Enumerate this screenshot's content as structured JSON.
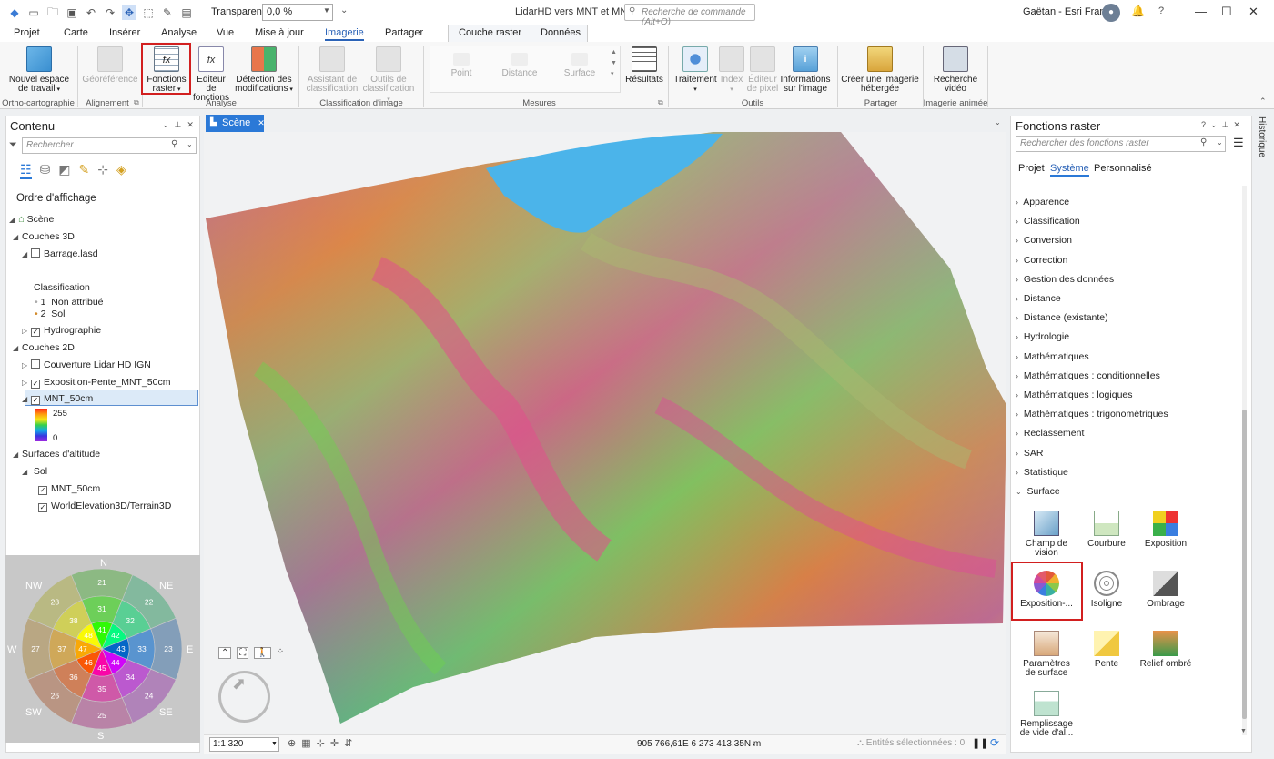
{
  "titlebar": {
    "transparency_label": "Transparence",
    "transparency_value": "0,0 %",
    "app_title": "LidarHD vers MNT et MNS",
    "command_search_placeholder": "Recherche de commande (Alt+Q)",
    "user": "Gaëtan - Esri France"
  },
  "menu": {
    "tabs": [
      "Projet",
      "Carte",
      "Insérer",
      "Analyse",
      "Vue",
      "Mise à jour",
      "Imagerie",
      "Partager"
    ],
    "active": "Imagerie",
    "context_tabs": [
      "Couche raster",
      "Données"
    ]
  },
  "ribbon": {
    "nouvel_espace": "Nouvel espace de travail",
    "georeference": "Géoréférence",
    "fonctions_raster": "Fonctions raster",
    "editeur_fonctions": "Editeur de fonctions",
    "detection": "Détection des modifications",
    "assistant": "Assistant de classification",
    "outils_classification": "Outils de classification",
    "point": "Point",
    "distance": "Distance",
    "surface": "Surface",
    "resultats": "Résultats",
    "traitement": "Traitement",
    "index": "Index",
    "editeur_pixel": "Éditeur de pixel",
    "informations": "Informations sur l'image",
    "creer_imagerie": "Créer une imagerie hébergée",
    "recherche_video": "Recherche vidéo",
    "groups": {
      "ortho": "Ortho-cartographie",
      "alignement": "Alignement",
      "analyse": "Analyse",
      "classification": "Classification d'image",
      "mesures": "Mesures",
      "outils": "Outils",
      "partager": "Partager",
      "imagerie_animee": "Imagerie animée"
    }
  },
  "content": {
    "title": "Contenu",
    "search_placeholder": "Rechercher",
    "section": "Ordre d'affichage",
    "scene": "Scène",
    "couches3d": "Couches 3D",
    "barrage": "Barrage.lasd",
    "classification": "Classification",
    "class1_code": "1",
    "class1_label": "Non attribué",
    "class2_code": "2",
    "class2_label": "Sol",
    "hydrographie": "Hydrographie",
    "couches2d": "Couches 2D",
    "couverture": "Couverture Lidar HD IGN",
    "exposition_pente": "Exposition-Pente_MNT_50cm",
    "mnt": "MNT_50cm",
    "legend_max": "255",
    "legend_min": "0",
    "surfaces": "Surfaces d'altitude",
    "sol": "Sol",
    "surface_mnt": "MNT_50cm",
    "world_elevation": "WorldElevation3D/Terrain3D"
  },
  "compass": {
    "N": "N",
    "NE": "NE",
    "E": "E",
    "SE": "SE",
    "S": "S",
    "SW": "SW",
    "W": "W",
    "NW": "NW",
    "outer": [
      "21",
      "22",
      "23",
      "24",
      "25",
      "26",
      "27",
      "28"
    ],
    "middle": [
      "31",
      "32",
      "33",
      "34",
      "35",
      "36",
      "37",
      "38"
    ],
    "inner": [
      "41",
      "42",
      "43",
      "44",
      "45",
      "46",
      "47",
      "48"
    ]
  },
  "scene": {
    "tab": "Scène",
    "scale": "1:1 320",
    "coords": "905 766,61E 6 273 413,35N m",
    "selected": "Entités sélectionnées : 0"
  },
  "raster_functions": {
    "title": "Fonctions raster",
    "search_placeholder": "Rechercher des fonctions raster",
    "tabs": [
      "Projet",
      "Système",
      "Personnalisé"
    ],
    "active_tab": "Système",
    "categories": [
      "Apparence",
      "Classification",
      "Conversion",
      "Correction",
      "Gestion des données",
      "Distance",
      "Distance (existante)",
      "Hydrologie",
      "Mathématiques",
      "Mathématiques : conditionnelles",
      "Mathématiques : logiques",
      "Mathématiques : trigonométriques",
      "Reclassement",
      "SAR",
      "Statistique"
    ],
    "expanded": "Surface",
    "tools": [
      "Champ de vision",
      "Courbure",
      "Exposition",
      "Exposition-...",
      "Isoligne",
      "Ombrage",
      "Paramètres de surface",
      "Pente",
      "Relief ombré",
      "Remplissage de vide d'al..."
    ]
  },
  "history_label": "Historique",
  "colors": {
    "accent": "#2b79d7",
    "highlight": "#d21f1f",
    "selection": "#dceaf8"
  }
}
